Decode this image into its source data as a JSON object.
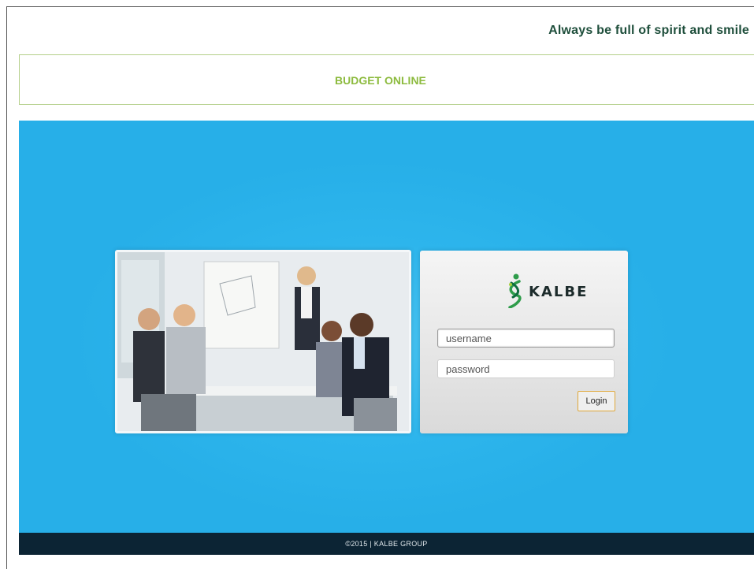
{
  "header": {
    "tagline": "Always be full of spirit and smile"
  },
  "banner": {
    "title": "BUDGET ONLINE"
  },
  "login": {
    "brand": "KALBE",
    "username_placeholder": "username",
    "password_placeholder": "password",
    "button_label": "Login"
  },
  "footer": {
    "text": "©2015 | KALBE GROUP"
  },
  "colors": {
    "hero_blue": "#2db5ec",
    "banner_green": "#8dbb3f",
    "tagline_green": "#1f4f3c",
    "footer_dark": "#0c2434",
    "button_border": "#e0a83a"
  },
  "icons": [
    "kalbe-logo-icon",
    "office-team-photo"
  ]
}
